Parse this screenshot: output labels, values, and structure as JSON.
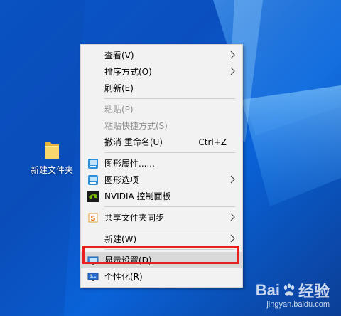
{
  "desktop": {
    "icon_label": "新建文件夹"
  },
  "context_menu": {
    "items": [
      {
        "label": "查看(V)"
      },
      {
        "label": "排序方式(O)"
      },
      {
        "label": "刷新(E)"
      },
      {
        "label": "粘贴(P)"
      },
      {
        "label": "粘贴快捷方式(S)"
      },
      {
        "label": "撤消 重命名(U)",
        "shortcut": "Ctrl+Z"
      },
      {
        "label": "图形属性......"
      },
      {
        "label": "图形选项"
      },
      {
        "label": "NVIDIA 控制面板"
      },
      {
        "label": "共享文件夹同步"
      },
      {
        "label": "新建(W)"
      },
      {
        "label": "显示设置(D)"
      },
      {
        "label": "个性化(R)"
      }
    ]
  },
  "watermark": {
    "brand": "Bai",
    "brand_suffix": "经验",
    "url": "jingyan.baidu.com"
  },
  "colors": {
    "highlight_outline": "#e8201f",
    "desktop_blue": "#0a56c8"
  }
}
